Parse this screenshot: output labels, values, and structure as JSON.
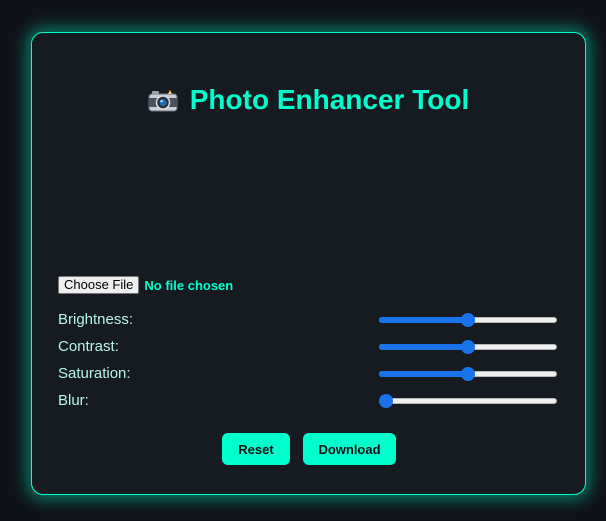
{
  "header": {
    "icon": "camera-icon",
    "title": "Photo Enhancer Tool"
  },
  "file_input": {
    "button_label": "Choose File",
    "status": "No file chosen"
  },
  "controls": [
    {
      "label": "Brightness:",
      "value": 100,
      "min": 0,
      "max": 200
    },
    {
      "label": "Contrast:",
      "value": 100,
      "min": 0,
      "max": 200
    },
    {
      "label": "Saturation:",
      "value": 100,
      "min": 0,
      "max": 200
    },
    {
      "label": "Blur:",
      "value": 0,
      "min": 0,
      "max": 10
    }
  ],
  "buttons": {
    "reset_label": "Reset",
    "download_label": "Download"
  },
  "colors": {
    "accent": "#00ffcc",
    "card_bg": "#161b22",
    "page_bg": "#0f1319",
    "slider_fill": "#1a73e8"
  }
}
